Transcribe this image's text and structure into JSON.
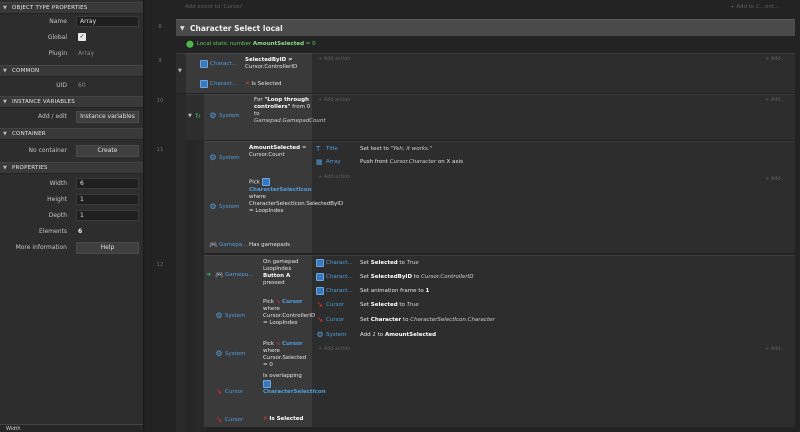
{
  "props": {
    "sections": {
      "object_type": "OBJECT TYPE PROPERTIES",
      "common": "COMMON",
      "instance_vars": "INSTANCE VARIABLES",
      "container": "CONTAINER",
      "properties": "PROPERTIES"
    },
    "name_label": "Name",
    "name_value": "Array",
    "global_label": "Global",
    "plugin_label": "Plugin",
    "plugin_value": "Array",
    "uid_label": "UID",
    "uid_value": "60",
    "addedit_label": "Add / edit",
    "instance_vars_btn": "Instance variables",
    "container_label": "No container",
    "create_btn": "Create",
    "width_label": "Width",
    "width_value": "6",
    "height_label": "Height",
    "height_value": "1",
    "depth_label": "Depth",
    "depth_value": "1",
    "elements_label": "Elements",
    "elements_value": "6",
    "moreinfo_label": "More information",
    "help_btn": "Help",
    "bottom_label": "Width"
  },
  "sheet": {
    "add_event_top": "Add event to 'Cursor'",
    "add_group_top": "+ Add to C...ont...",
    "group_title": "Character Select local",
    "local_var": {
      "prefix": "Local static number",
      "name": "AmountSelected",
      "suffix": "= 0"
    },
    "line_nums": [
      "8",
      "9",
      "10",
      "11",
      "12"
    ],
    "add_action": "+ Add action",
    "add_short": "+ Add...",
    "ev9": {
      "c1_obj": "Charact...",
      "c1_text_b": "SelectedByID",
      "c1_text": " ≠ Cursor.ControllerID",
      "c2_obj": "Charact...",
      "c2_text": "Is Selected"
    },
    "ev10": {
      "obj": "System",
      "text_pre": "For",
      "text_b": "\"Loop through controllers\"",
      "text_mid": " from ",
      "text_0": "0",
      "text_to": " to ",
      "text_i": "Gamepad.GamepadCount"
    },
    "ev11": {
      "c1_obj": "System",
      "c1_text_b": "AmountSelected",
      "c1_text": " = Cursor.Count",
      "c2_obj": "System",
      "c2_pick": "Pick",
      "c2_obj2": "CharacterSelectIcon",
      "c2_text": " where CharacterSelectIcon.SelectedByID = LoopIndex",
      "c3_obj": "Gamepa...",
      "c3_text": "Has gamepads",
      "a1_obj": "Title",
      "a1_text": "Set text to ",
      "a1_i": "\"Yeh, it works.\"",
      "a2_obj": "Array",
      "a2_text": "Push front ",
      "a2_i": "Cursor.Character",
      "a2_text2": " on X axis"
    },
    "ev12": {
      "c1_obj": "Gamepa...",
      "c1_text": "On gamepad LoopIndex ",
      "c1_b": "Button A",
      "c1_text2": " pressed",
      "c2_obj": "System",
      "c2_pick": "Pick",
      "c2_obj2": "Cursor",
      "c2_text": " where Cursor.ControllerID = LoopIndex",
      "c3_obj": "System",
      "c3_pick": "Pick",
      "c3_obj2": "Cursor",
      "c3_text": " where Cursor.Selected = 0",
      "c4_obj": "Cursor",
      "c4_text": "Is overlapping",
      "c4_obj2": "CharacterSelectIcon",
      "c5_obj": "Cursor",
      "c5_text": "Is Selected",
      "actions": [
        {
          "obj": "Charact...",
          "icon": "blue",
          "pre": "Set ",
          "b": "Selected",
          "mid": " to ",
          "i": "True"
        },
        {
          "obj": "Charact...",
          "icon": "blue",
          "pre": "Set ",
          "b": "SelectedByID",
          "mid": " to ",
          "i": "Cursor.ControllerID"
        },
        {
          "obj": "Charact...",
          "icon": "blue",
          "pre": "Set animation frame to ",
          "b": "1",
          "mid": "",
          "i": ""
        },
        {
          "obj": "Cursor",
          "icon": "cur",
          "pre": "Set ",
          "b": "Selected",
          "mid": " to ",
          "i": "True"
        },
        {
          "obj": "Cursor",
          "icon": "cur",
          "pre": "Set ",
          "b": "Character",
          "mid": " to ",
          "i": "CharacterSelectIcon.Character"
        },
        {
          "obj": "System",
          "icon": "gear",
          "pre": "Add ",
          "b": "AmountSelected",
          "mid": "",
          "i": "1",
          "to": " to "
        }
      ]
    }
  }
}
